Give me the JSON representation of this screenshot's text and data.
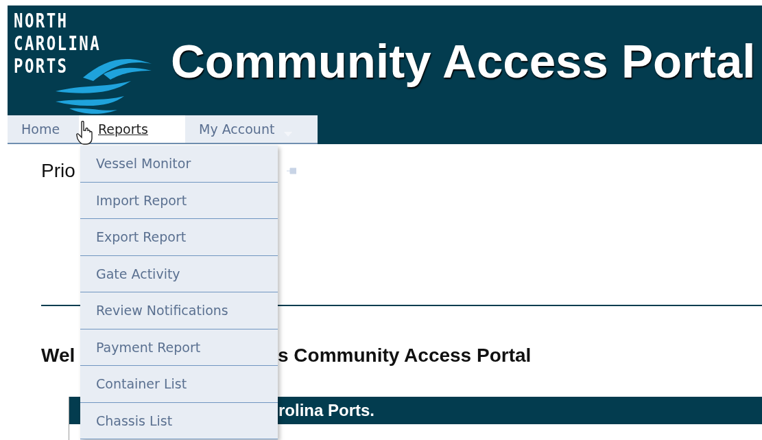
{
  "header": {
    "logo_lines": [
      "NORTH",
      "CAROLINA",
      "PORTS"
    ],
    "title": "Community Access Portal"
  },
  "nav": [
    {
      "label": "Home",
      "selected": false,
      "has_menu": false
    },
    {
      "label": "Reports",
      "selected": true,
      "has_menu": false
    },
    {
      "label": "My Account",
      "selected": false,
      "has_menu": true
    }
  ],
  "dropdown": {
    "items": [
      "Vessel Monitor",
      "Import Report",
      "Export Report",
      "Gate Activity",
      "Review Notifications",
      "Payment Report",
      "Container List",
      "Chassis List"
    ]
  },
  "content": {
    "heading": "Prio",
    "welcome_left": "Wel",
    "welcome_right": "s Community Access Portal",
    "banner": "rolina Ports."
  }
}
